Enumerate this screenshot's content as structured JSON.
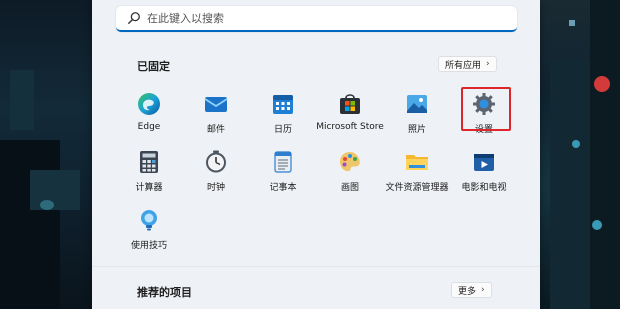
{
  "search": {
    "placeholder": "在此键入以搜索",
    "icon": "search-icon"
  },
  "pinned": {
    "title": "已固定",
    "all_apps": "所有应用",
    "apps": [
      {
        "label": "Edge",
        "icon": "edge-icon"
      },
      {
        "label": "邮件",
        "icon": "mail-icon"
      },
      {
        "label": "日历",
        "icon": "calendar-icon"
      },
      {
        "label": "Microsoft Store",
        "icon": "store-icon"
      },
      {
        "label": "照片",
        "icon": "photos-icon"
      },
      {
        "label": "设置",
        "icon": "settings-icon"
      },
      {
        "label": "计算器",
        "icon": "calculator-icon"
      },
      {
        "label": "时钟",
        "icon": "clock-icon"
      },
      {
        "label": "记事本",
        "icon": "notepad-icon"
      },
      {
        "label": "画图",
        "icon": "paint-icon"
      },
      {
        "label": "文件资源管理器",
        "icon": "folder-icon"
      },
      {
        "label": "电影和电视",
        "icon": "movies-icon"
      },
      {
        "label": "使用技巧",
        "icon": "tips-icon"
      }
    ]
  },
  "recommended": {
    "title": "推荐的项目",
    "more": "更多"
  },
  "colors": {
    "accent": "#0067c0",
    "highlight": "#e0242c",
    "menu_bg": "#eef1f5"
  }
}
